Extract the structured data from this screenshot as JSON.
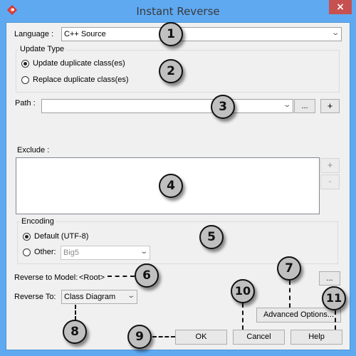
{
  "window": {
    "title": "Instant Reverse",
    "app_icon": "visual-paradigm-logo-icon",
    "close_label": "×",
    "close_icon": "close-icon"
  },
  "language": {
    "label": "Language :",
    "value": "C++ Source"
  },
  "update_type": {
    "title": "Update Type",
    "options": [
      {
        "label": "Update duplicate class(es)",
        "checked": true
      },
      {
        "label": "Replace duplicate class(es)",
        "checked": false
      }
    ]
  },
  "path": {
    "label": "Path :",
    "value": "",
    "browse_label": "...",
    "add_label": "+"
  },
  "exclude": {
    "label": "Exclude :",
    "items": [],
    "add_label": "+",
    "remove_label": "-"
  },
  "encoding": {
    "title": "Encoding",
    "options": [
      {
        "label": "Default (UTF-8)",
        "checked": true
      },
      {
        "label": "Other:",
        "checked": false
      }
    ],
    "other_value": "Big5"
  },
  "reverse_to_model": {
    "label": "Reverse to Model:",
    "value": "<Root>",
    "browse_label": "..."
  },
  "reverse_to": {
    "label": "Reverse To:",
    "value": "Class Diagram"
  },
  "buttons": {
    "advanced": "Advanced Options...",
    "ok": "OK",
    "cancel": "Cancel",
    "help": "Help"
  },
  "callouts": [
    "1",
    "2",
    "3",
    "4",
    "5",
    "6",
    "7",
    "8",
    "9",
    "10",
    "11"
  ],
  "chevron": "⌄"
}
